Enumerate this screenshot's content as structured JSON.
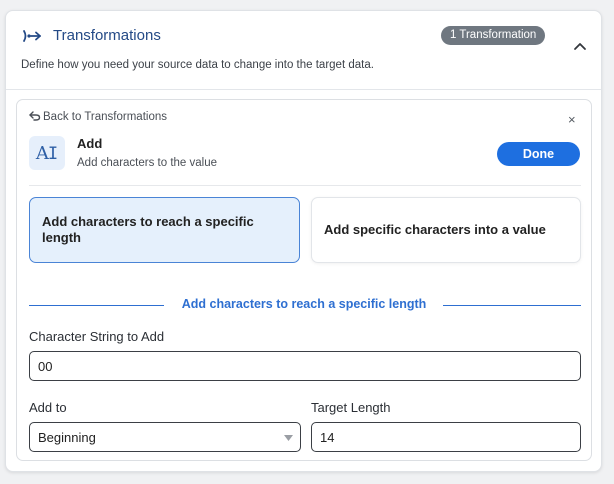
{
  "header": {
    "title": "Transformations",
    "badge": "1 Transformation",
    "subtitle": "Define how you need your source data to change into the target data.",
    "icon": "transform-arrow-icon",
    "toggle_icon": "chevron-up-icon"
  },
  "panel": {
    "back_label": "Back to Transformations",
    "close_label": "×",
    "add": {
      "title": "Add",
      "subtitle": "Add characters to the value",
      "icon_glyph": "A̶I"
    },
    "done_label": "Done",
    "options": [
      {
        "label": "Add characters to reach a specific length",
        "selected": true
      },
      {
        "label": "Add specific characters into a value",
        "selected": false
      }
    ],
    "section_title": "Add characters to reach a specific length",
    "fields": {
      "character_string_label": "Character String to Add",
      "character_string_value": "00",
      "add_to_label": "Add to",
      "add_to_value": "Beginning",
      "target_length_label": "Target Length",
      "target_length_value": "14"
    }
  },
  "colors": {
    "accent": "#1e6fe0",
    "title_blue": "#244a86",
    "selected_bg": "#e5f0fc",
    "badge_bg": "#6f7780"
  }
}
